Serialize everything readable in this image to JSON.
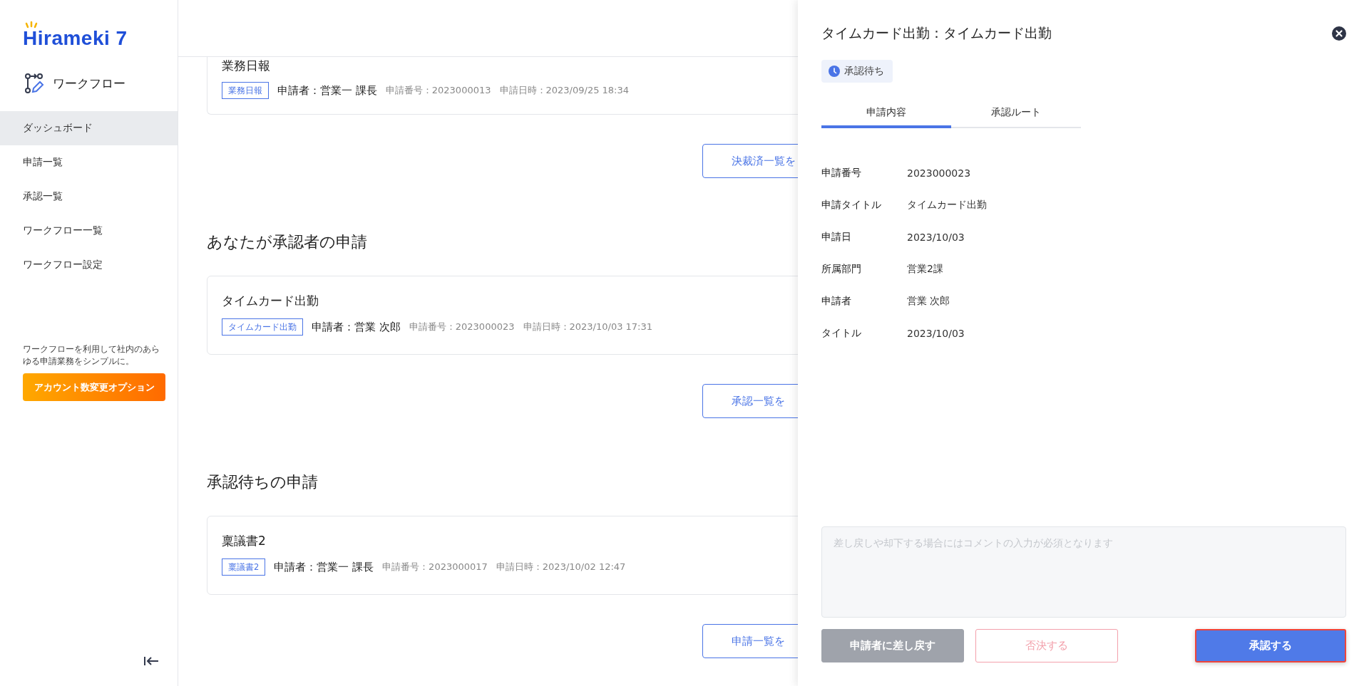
{
  "sidebar": {
    "logo": "Hirameki 7",
    "app_title": "ワークフロー",
    "nav": [
      {
        "label": "ダッシュボード",
        "selected": true
      },
      {
        "label": "申請一覧",
        "selected": false
      },
      {
        "label": "承認一覧",
        "selected": false
      },
      {
        "label": "ワークフロー一覧",
        "selected": false
      },
      {
        "label": "ワークフロー設定",
        "selected": false
      }
    ],
    "promo_text": "ワークフローを利用して社内のあらゆる申請業務をシンプルに。",
    "promo_button": "アカウント数変更オプション"
  },
  "main": {
    "groups": [
      {
        "cards": [
          {
            "title": "業務日報",
            "tag": "業務日報",
            "applicant": "申請者：営業一 課長",
            "number": "申請番号：2023000013",
            "datetime": "申請日時：2023/09/25 18:34"
          }
        ],
        "more_button": "決裁済一覧を"
      },
      {
        "heading": "あなたが承認者の申請",
        "cards": [
          {
            "title": "タイムカード出勤",
            "tag": "タイムカード出勤",
            "applicant": "申請者：営業 次郎",
            "number": "申請番号：2023000023",
            "datetime": "申請日時：2023/10/03 17:31"
          }
        ],
        "more_button": "承認一覧を"
      },
      {
        "heading": "承認待ちの申請",
        "cards": [
          {
            "title": "稟議書2",
            "tag": "稟議書2",
            "applicant": "申請者：営業一 課長",
            "number": "申請番号：2023000017",
            "datetime": "申請日時：2023/10/02 12:47"
          }
        ],
        "more_button": "申請一覧を"
      }
    ]
  },
  "drawer": {
    "title": "タイムカード出勤：タイムカード出勤",
    "status": "承認待ち",
    "tabs": [
      {
        "label": "申請内容",
        "selected": true
      },
      {
        "label": "承認ルート",
        "selected": false
      }
    ],
    "fields": [
      {
        "label": "申請番号",
        "value": "2023000023"
      },
      {
        "label": "申請タイトル",
        "value": "タイムカード出勤"
      },
      {
        "label": "申請日",
        "value": "2023/10/03"
      },
      {
        "label": "所属部門",
        "value": "営業2課"
      },
      {
        "label": "申請者",
        "value": "営業 次郎"
      },
      {
        "label": "タイトル",
        "value": "2023/10/03"
      }
    ],
    "comment": {
      "placeholder": "差し戻しや却下する場合にはコメントの入力が必須となります"
    },
    "buttons": [
      {
        "label": "申請者に差し戻す",
        "kind": "return",
        "disabled": true
      },
      {
        "label": "否決する",
        "kind": "reject",
        "disabled": true
      },
      {
        "label": "承認する",
        "kind": "approve",
        "disabled": false
      }
    ]
  }
}
